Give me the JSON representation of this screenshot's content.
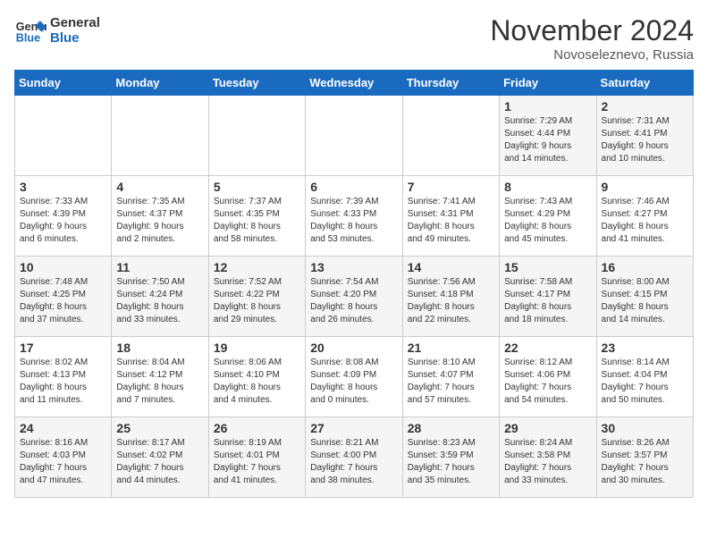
{
  "header": {
    "logo_line1": "General",
    "logo_line2": "Blue",
    "month_title": "November 2024",
    "location": "Novoseleznevo, Russia"
  },
  "weekdays": [
    "Sunday",
    "Monday",
    "Tuesday",
    "Wednesday",
    "Thursday",
    "Friday",
    "Saturday"
  ],
  "weeks": [
    [
      {
        "day": "",
        "info": ""
      },
      {
        "day": "",
        "info": ""
      },
      {
        "day": "",
        "info": ""
      },
      {
        "day": "",
        "info": ""
      },
      {
        "day": "",
        "info": ""
      },
      {
        "day": "1",
        "info": "Sunrise: 7:29 AM\nSunset: 4:44 PM\nDaylight: 9 hours\nand 14 minutes."
      },
      {
        "day": "2",
        "info": "Sunrise: 7:31 AM\nSunset: 4:41 PM\nDaylight: 9 hours\nand 10 minutes."
      }
    ],
    [
      {
        "day": "3",
        "info": "Sunrise: 7:33 AM\nSunset: 4:39 PM\nDaylight: 9 hours\nand 6 minutes."
      },
      {
        "day": "4",
        "info": "Sunrise: 7:35 AM\nSunset: 4:37 PM\nDaylight: 9 hours\nand 2 minutes."
      },
      {
        "day": "5",
        "info": "Sunrise: 7:37 AM\nSunset: 4:35 PM\nDaylight: 8 hours\nand 58 minutes."
      },
      {
        "day": "6",
        "info": "Sunrise: 7:39 AM\nSunset: 4:33 PM\nDaylight: 8 hours\nand 53 minutes."
      },
      {
        "day": "7",
        "info": "Sunrise: 7:41 AM\nSunset: 4:31 PM\nDaylight: 8 hours\nand 49 minutes."
      },
      {
        "day": "8",
        "info": "Sunrise: 7:43 AM\nSunset: 4:29 PM\nDaylight: 8 hours\nand 45 minutes."
      },
      {
        "day": "9",
        "info": "Sunrise: 7:46 AM\nSunset: 4:27 PM\nDaylight: 8 hours\nand 41 minutes."
      }
    ],
    [
      {
        "day": "10",
        "info": "Sunrise: 7:48 AM\nSunset: 4:25 PM\nDaylight: 8 hours\nand 37 minutes."
      },
      {
        "day": "11",
        "info": "Sunrise: 7:50 AM\nSunset: 4:24 PM\nDaylight: 8 hours\nand 33 minutes."
      },
      {
        "day": "12",
        "info": "Sunrise: 7:52 AM\nSunset: 4:22 PM\nDaylight: 8 hours\nand 29 minutes."
      },
      {
        "day": "13",
        "info": "Sunrise: 7:54 AM\nSunset: 4:20 PM\nDaylight: 8 hours\nand 26 minutes."
      },
      {
        "day": "14",
        "info": "Sunrise: 7:56 AM\nSunset: 4:18 PM\nDaylight: 8 hours\nand 22 minutes."
      },
      {
        "day": "15",
        "info": "Sunrise: 7:58 AM\nSunset: 4:17 PM\nDaylight: 8 hours\nand 18 minutes."
      },
      {
        "day": "16",
        "info": "Sunrise: 8:00 AM\nSunset: 4:15 PM\nDaylight: 8 hours\nand 14 minutes."
      }
    ],
    [
      {
        "day": "17",
        "info": "Sunrise: 8:02 AM\nSunset: 4:13 PM\nDaylight: 8 hours\nand 11 minutes."
      },
      {
        "day": "18",
        "info": "Sunrise: 8:04 AM\nSunset: 4:12 PM\nDaylight: 8 hours\nand 7 minutes."
      },
      {
        "day": "19",
        "info": "Sunrise: 8:06 AM\nSunset: 4:10 PM\nDaylight: 8 hours\nand 4 minutes."
      },
      {
        "day": "20",
        "info": "Sunrise: 8:08 AM\nSunset: 4:09 PM\nDaylight: 8 hours\nand 0 minutes."
      },
      {
        "day": "21",
        "info": "Sunrise: 8:10 AM\nSunset: 4:07 PM\nDaylight: 7 hours\nand 57 minutes."
      },
      {
        "day": "22",
        "info": "Sunrise: 8:12 AM\nSunset: 4:06 PM\nDaylight: 7 hours\nand 54 minutes."
      },
      {
        "day": "23",
        "info": "Sunrise: 8:14 AM\nSunset: 4:04 PM\nDaylight: 7 hours\nand 50 minutes."
      }
    ],
    [
      {
        "day": "24",
        "info": "Sunrise: 8:16 AM\nSunset: 4:03 PM\nDaylight: 7 hours\nand 47 minutes."
      },
      {
        "day": "25",
        "info": "Sunrise: 8:17 AM\nSunset: 4:02 PM\nDaylight: 7 hours\nand 44 minutes."
      },
      {
        "day": "26",
        "info": "Sunrise: 8:19 AM\nSunset: 4:01 PM\nDaylight: 7 hours\nand 41 minutes."
      },
      {
        "day": "27",
        "info": "Sunrise: 8:21 AM\nSunset: 4:00 PM\nDaylight: 7 hours\nand 38 minutes."
      },
      {
        "day": "28",
        "info": "Sunrise: 8:23 AM\nSunset: 3:59 PM\nDaylight: 7 hours\nand 35 minutes."
      },
      {
        "day": "29",
        "info": "Sunrise: 8:24 AM\nSunset: 3:58 PM\nDaylight: 7 hours\nand 33 minutes."
      },
      {
        "day": "30",
        "info": "Sunrise: 8:26 AM\nSunset: 3:57 PM\nDaylight: 7 hours\nand 30 minutes."
      }
    ]
  ]
}
